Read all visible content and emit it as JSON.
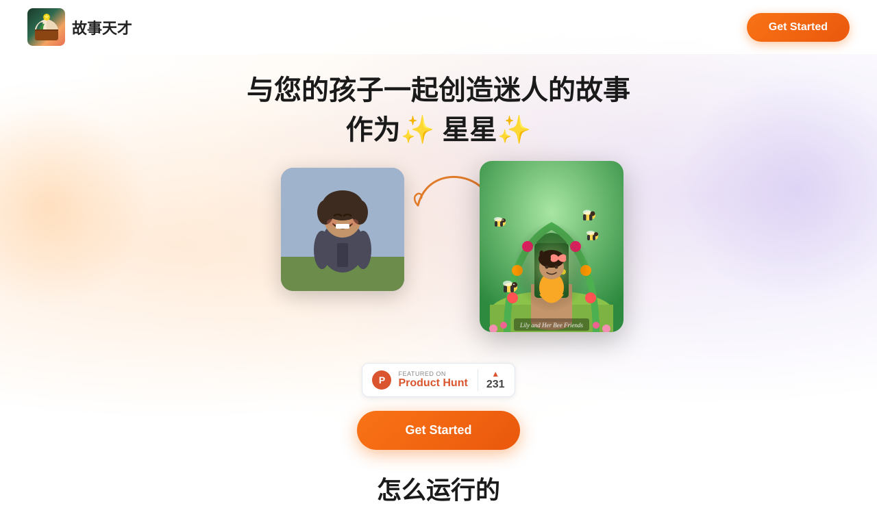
{
  "app": {
    "name": "故事天才",
    "logo_alt": "Story Genius Logo"
  },
  "navbar": {
    "get_started_label": "Get Started"
  },
  "hero": {
    "headline_line1": "与您的孩子一起创造迷人的故事",
    "headline_line2": "作为✨     星星✨",
    "arrow_alt": "transformation arrow"
  },
  "product_hunt": {
    "featured_on": "FEATURED ON",
    "name": "Product Hunt",
    "vote_count": "231"
  },
  "cta": {
    "label": "Get Started"
  },
  "bottom": {
    "how_it_works": "怎么运行的"
  },
  "storybook": {
    "title": "Lily and Her Bee Friends"
  },
  "colors": {
    "orange": "#f97316",
    "orange_dark": "#ea580c",
    "ph_red": "#da552f"
  }
}
